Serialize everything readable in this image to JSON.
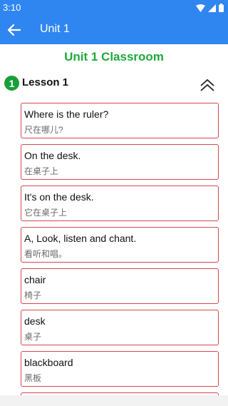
{
  "status": {
    "time": "3:10"
  },
  "appbar": {
    "title": "Unit 1",
    "back_icon": "arrow-left-icon"
  },
  "page": {
    "title": "Unit 1 Classroom"
  },
  "lesson": {
    "number": "1",
    "title": "Lesson 1",
    "toggle_icon": "double-chevron-up-icon"
  },
  "colors": {
    "primary": "#2f86f0",
    "accent_green": "#1faa3a",
    "card_border": "#d9454f"
  },
  "items": [
    {
      "en": "Where is the ruler?",
      "zh": "尺在哪儿?"
    },
    {
      "en": "On the desk.",
      "zh": "在桌子上"
    },
    {
      "en": "It's on the desk.",
      "zh": "它在桌子上"
    },
    {
      "en": "A, Look, listen and chant.",
      "zh": "看听和唱。"
    },
    {
      "en": "chair",
      "zh": "椅子"
    },
    {
      "en": "desk",
      "zh": "桌子"
    },
    {
      "en": "blackboard",
      "zh": " 黑板"
    }
  ]
}
